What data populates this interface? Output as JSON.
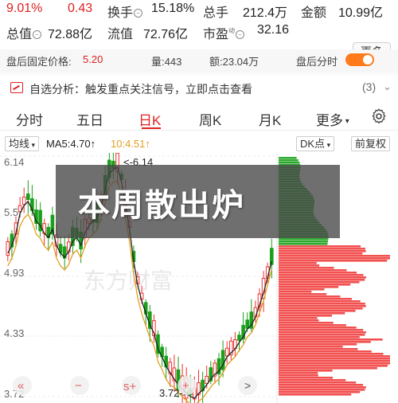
{
  "quote": {
    "price": "9.01%",
    "change": "0.43",
    "turnover_label": "换手",
    "turnover": "15.18%",
    "volume_label": "总手",
    "volume": "212.4万",
    "amount_label": "金额",
    "amount": "10.99亿",
    "mktcap_label": "总值",
    "mktcap": "72.88亿",
    "float_label": "流值",
    "float": "72.76亿",
    "pe_label": "市盈",
    "pe_sup": "动",
    "pe": "32.16",
    "more_button": "更多"
  },
  "after_hours": {
    "price_label": "盘后固定价格:",
    "price": "5.20",
    "volume": "量:443",
    "amount": "额:23.04万",
    "toggle_label": "盘后分时",
    "toggle_on": true
  },
  "notify": {
    "text": "自选分析：触发重点关注信号，立即点击查看",
    "count": "(3)",
    "chevron": "⌄"
  },
  "tabs": [
    "分时",
    "五日",
    "日K",
    "周K",
    "月K",
    "更多"
  ],
  "active_tab": "日K",
  "indicators": {
    "ma_select": "均线",
    "ma5": "MA5:4.70↑",
    "ma10": "10:4.51↑",
    "dk_select": "DK点",
    "fq_button": "前复权"
  },
  "chart_data": {
    "type": "candlestick",
    "y_tick_labels": [
      "6.14",
      "5.5",
      "4.93",
      "4.33",
      "3.72"
    ],
    "high_marker": "<-6.14",
    "low_marker": "3.72->",
    "watermark": "东方财富",
    "colors": {
      "up": "#f03030",
      "down": "#1aa01a",
      "ma5": "#222222",
      "ma10": "#e0a020",
      "profile_up": "#f03030",
      "profile_down": "#1aa01a"
    }
  },
  "controls": {
    "prev": "«",
    "minus": "−",
    "s_plus": "s+",
    "plus": "+",
    "next": ">"
  },
  "banner": {
    "text": "本周散出炉"
  }
}
